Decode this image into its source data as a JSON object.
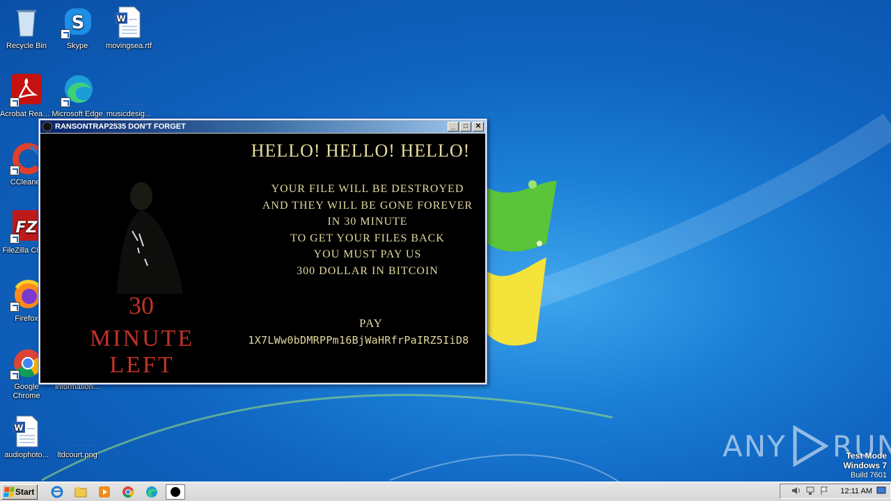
{
  "desktop": {
    "icons": [
      {
        "label": "Recycle Bin",
        "icon": "recycle-bin-icon"
      },
      {
        "label": "Skype",
        "icon": "skype-icon"
      },
      {
        "label": "movingsea.rtf",
        "icon": "word-document-icon"
      },
      {
        "label": "Acrobat Reader DC",
        "icon": "acrobat-icon"
      },
      {
        "label": "Microsoft Edge",
        "icon": "edge-icon"
      },
      {
        "label": "musicdesig...",
        "icon": "image-file-icon"
      },
      {
        "label": "CCleaner",
        "icon": "ccleaner-icon"
      },
      {
        "label": "FileZilla Client",
        "icon": "filezilla-icon"
      },
      {
        "label": "Firefox",
        "icon": "firefox-icon"
      },
      {
        "label": "Google Chrome",
        "icon": "chrome-icon"
      },
      {
        "label": "information...",
        "icon": "file-icon"
      },
      {
        "label": "audiophoto...",
        "icon": "word-document-icon"
      },
      {
        "label": "ltdcourt.png",
        "icon": "image-file-icon"
      }
    ]
  },
  "window": {
    "title": "RANSONTRAP2535 DON'T FORGET",
    "buttons": {
      "minimize": "_",
      "maximize": "□",
      "close": "✕"
    },
    "timer": {
      "number": "30",
      "label": "MINUTE LEFT"
    },
    "headline": "HELLO! HELLO! HELLO!",
    "message_lines": [
      "YOUR FILE WILL BE DESTROYED",
      "AND THEY WILL BE GONE FOREVER",
      "IN 30 MINUTE",
      "TO GET YOUR FILES BACK",
      "YOU MUST PAY US",
      "300 DOLLAR IN BITCOIN"
    ],
    "pay_label": "PAY",
    "bitcoin_address": "1X7LWw0bDMRPPm16BjWaHRfrPaIRZ5IiD8"
  },
  "watermark": {
    "left": "ANY",
    "right": "RUN"
  },
  "os_info": {
    "line1": "Test Mode",
    "line2": "Windows 7",
    "line3": "Build 7601"
  },
  "taskbar": {
    "start_label": "Start",
    "quick_launch": [
      "ie-icon",
      "explorer-icon",
      "media-player-icon",
      "chrome-icon",
      "edge-icon",
      "app-icon"
    ],
    "clock": "12:11 AM"
  },
  "colors": {
    "title_gradient_start": "#0a246a",
    "ransom_red": "#c23228",
    "ransom_text": "#e2d9a0"
  }
}
